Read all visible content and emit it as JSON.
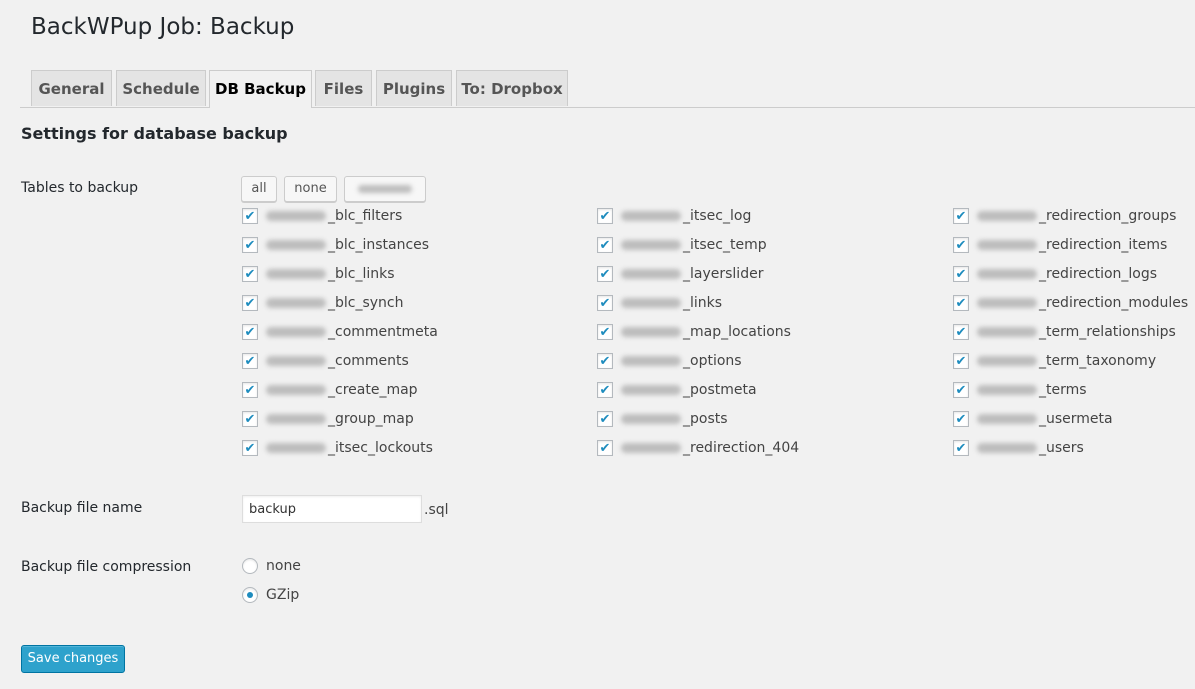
{
  "page_title": "BackWPup Job: Backup",
  "tabs": [
    {
      "label": "General"
    },
    {
      "label": "Schedule"
    },
    {
      "label": "DB Backup"
    },
    {
      "label": "Files"
    },
    {
      "label": "Plugins"
    },
    {
      "label": "To: Dropbox"
    }
  ],
  "active_tab": "DB Backup",
  "section_title": "Settings for database backup",
  "tables": {
    "label": "Tables to backup",
    "buttons": {
      "all": "all",
      "none": "none"
    },
    "columns": [
      [
        {
          "name": "_blc_filters",
          "checked": true
        },
        {
          "name": "_blc_instances",
          "checked": true
        },
        {
          "name": "_blc_links",
          "checked": true
        },
        {
          "name": "_blc_synch",
          "checked": true
        },
        {
          "name": "_commentmeta",
          "checked": true
        },
        {
          "name": "_comments",
          "checked": true
        },
        {
          "name": "_create_map",
          "checked": true
        },
        {
          "name": "_group_map",
          "checked": true
        },
        {
          "name": "_itsec_lockouts",
          "checked": true
        }
      ],
      [
        {
          "name": "_itsec_log",
          "checked": true
        },
        {
          "name": "_itsec_temp",
          "checked": true
        },
        {
          "name": "_layerslider",
          "checked": true
        },
        {
          "name": "_links",
          "checked": true
        },
        {
          "name": "_map_locations",
          "checked": true
        },
        {
          "name": "_options",
          "checked": true
        },
        {
          "name": "_postmeta",
          "checked": true
        },
        {
          "name": "_posts",
          "checked": true
        },
        {
          "name": "_redirection_404",
          "checked": true
        }
      ],
      [
        {
          "name": "_redirection_groups",
          "checked": true
        },
        {
          "name": "_redirection_items",
          "checked": true
        },
        {
          "name": "_redirection_logs",
          "checked": true
        },
        {
          "name": "_redirection_modules",
          "checked": true
        },
        {
          "name": "_term_relationships",
          "checked": true
        },
        {
          "name": "_term_taxonomy",
          "checked": true
        },
        {
          "name": "_terms",
          "checked": true
        },
        {
          "name": "_usermeta",
          "checked": true
        },
        {
          "name": "_users",
          "checked": true
        }
      ]
    ]
  },
  "file_name": {
    "label": "Backup file name",
    "value": "backup",
    "suffix": ".sql"
  },
  "compression": {
    "label": "Backup file compression",
    "options": [
      {
        "label": "none",
        "selected": false
      },
      {
        "label": "GZip",
        "selected": true
      }
    ]
  },
  "save_button": "Save changes",
  "colors": {
    "accent": "#2ea2cc",
    "check": "#1e8cbe",
    "background": "#f1f1f1"
  }
}
